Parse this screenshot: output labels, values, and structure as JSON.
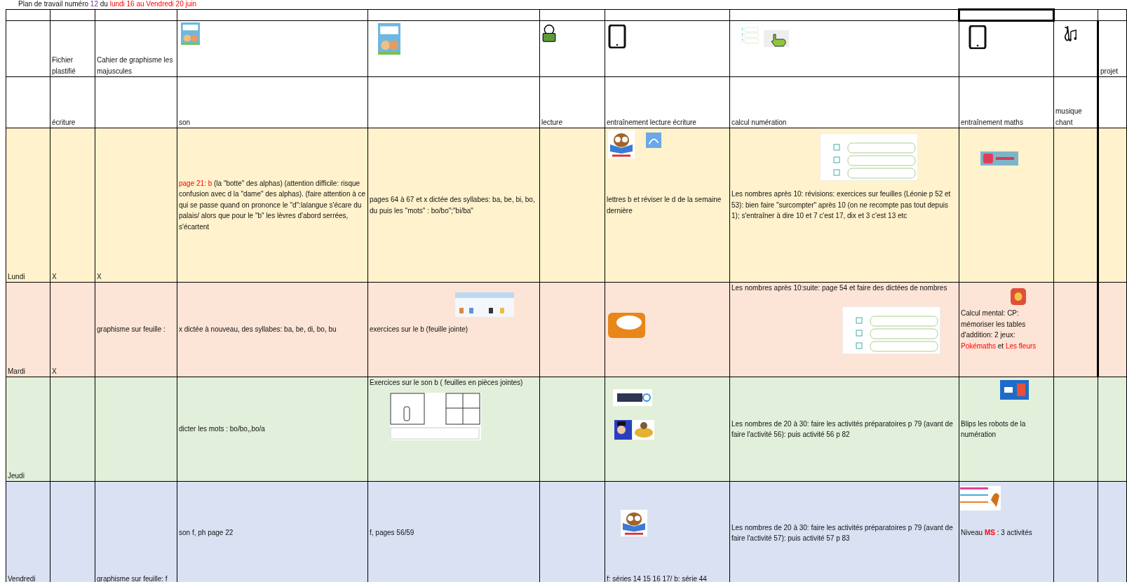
{
  "title": {
    "parts": [
      {
        "text": "Plan de travail numéro ",
        "kind": "plain"
      },
      {
        "text": "12",
        "kind": "number"
      },
      {
        "text": " du ",
        "kind": "plain"
      },
      {
        "text": "lundi 16 au Vendredi 20 juin",
        "kind": "highlight"
      }
    ]
  },
  "header_rows": [
    [
      null,
      "Fichier plastifié",
      "Cahier de graphisme les majuscules",
      null,
      null,
      null,
      null,
      null,
      null,
      null,
      "projet"
    ],
    [
      null,
      "écriture",
      null,
      "son",
      null,
      "lecture",
      "entraînement lecture écriture",
      "calcul numération",
      "entraînement  maths",
      "musique chant",
      null
    ]
  ],
  "days": [
    {
      "name": "Lundi",
      "color": "#fff2cc",
      "cells": [
        "X",
        "X",
        {
          "parts": [
            {
              "text": " page 21: b",
              "kind": "highlight"
            },
            {
              "text": " (la \"botte\" des alphas)  (attention difficile: risque confusion avec d la \"dame\" des alphas). (faire attention à ce qui se passe quand on prononce le \"d\":lalangue s'écare du palais/ alors que pour le \"b\" les lèvres d'abord serrées, s'écartent",
              "kind": "plain"
            }
          ]
        },
        "pages 64 à 67 et x dictée des syllabes: ba, be, bi, bo, du puis les \"mots\" : bo/bo\";\"bi/ba\"",
        null,
        "lettres b et réviser le d de la semaine dernière",
        "Les nombres après 10: révisions: exercices sur feuilles (Léonie p 52 et 53): bien faire \"surcompter\" après 10 (on ne recompte pas tout depuis 1); s'entraîner à dire 10 et 7 c'est 17, dix et 3 c'est 13 etc",
        null,
        null,
        null
      ]
    },
    {
      "name": "Mardi",
      "color": "#fce4d6",
      "cells": [
        "X",
        "graphisme sur feuille :",
        "x dictée à nouveau, des syllabes: ba, be, di, bo, bu",
        "exercices sur le b (feuille jointe)",
        null,
        null,
        "Les nombres après 10:suite: page 54 et faire des dictées de nombres",
        {
          "parts": [
            {
              "text": "Calcul mental:  CP: mémoriser les tables d'addition: 2 jeux: ",
              "kind": "plain"
            },
            {
              "text": "Pokémaths",
              "kind": "highlight"
            },
            {
              "text": " et ",
              "kind": "plain"
            },
            {
              "text": "Les fleurs",
              "kind": "highlight"
            }
          ]
        },
        null,
        null
      ]
    },
    {
      "name": "Jeudi",
      "color": "#e2efda",
      "cells": [
        null,
        null,
        "dicter les mots : bo/bo,,bo/a",
        "Exercices sur le son b ( feuilles en pièces jointes)",
        null,
        null,
        "Les nombres de 20 à 30: faire les activités préparatoires p 79 (avant de faire l'activité 56): puis activité 56 p 82",
        "Blips les robots de la numération",
        null,
        null
      ]
    },
    {
      "name": "Vendredi",
      "color": "#d9e1f2",
      "cells": [
        null,
        "graphisme sur feuille: f",
        "son f, ph page 22",
        "f, pages 56/59",
        null,
        "f: séries 14 15 16 17/ b: série 44",
        "Les nombres de 20 à 30: faire les activités préparatoires p 79 (avant de faire l'activité 57): puis activité 57 p 83",
        {
          "parts": [
            {
              "text": "Niveau ",
              "kind": "plain"
            },
            {
              "text": "MS",
              "kind": "emphasis"
            },
            {
              "text": " : 3 activités",
              "kind": "plain"
            }
          ]
        },
        null,
        null
      ]
    }
  ]
}
